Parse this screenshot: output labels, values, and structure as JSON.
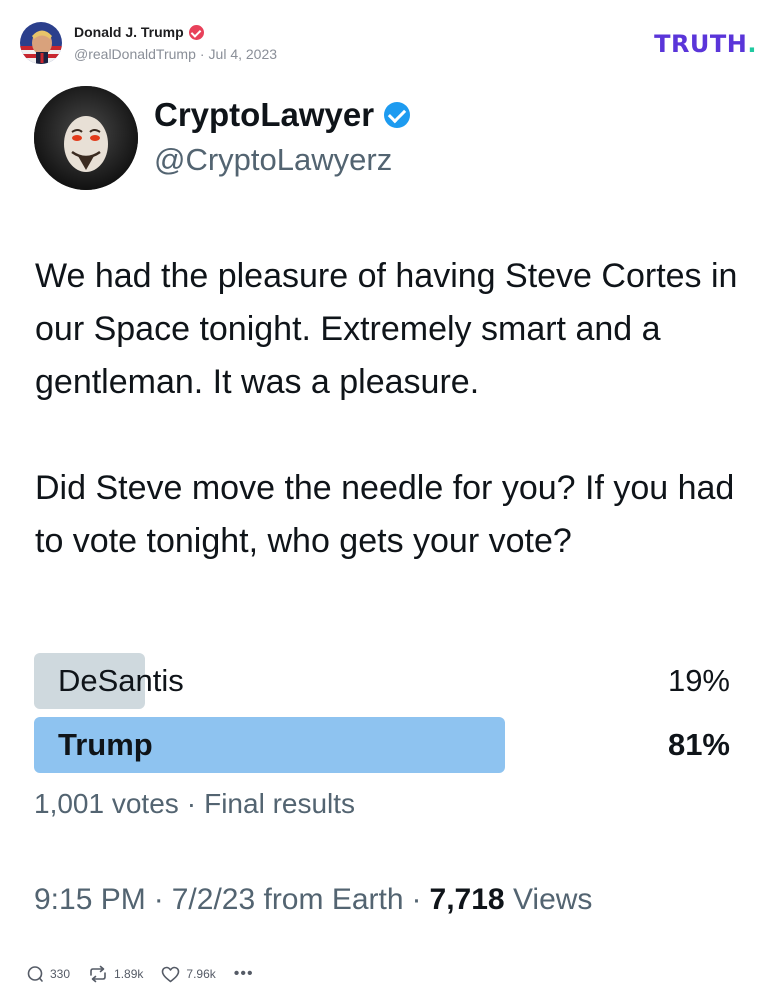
{
  "post": {
    "author_name": "Donald J. Trump",
    "handle": "@realDonaldTrump",
    "separator": "·",
    "date": "Jul 4, 2023",
    "logo_text": "TRUTH",
    "logo_dot": ".",
    "colors": {
      "logo": "#5a35d9",
      "logo_dot": "#20c9a0",
      "verified": "#e8415a"
    }
  },
  "tweet": {
    "name": "CryptoLawyer",
    "handle": "@CryptoLawyerz",
    "paragraph1": "We had the pleasure of having Steve Cortes in our Space tonight. Extremely smart and a gentleman. It was a pleasure.",
    "paragraph2": "Did Steve move the needle for you?  If you had to vote tonight, who gets your vote?",
    "poll": {
      "options": [
        {
          "label": "DeSantis",
          "percent_text": "19%",
          "percent": 19,
          "winner": false
        },
        {
          "label": "Trump",
          "percent_text": "81%",
          "percent": 81,
          "winner": true
        }
      ],
      "votes": "1,001 votes",
      "separator": "·",
      "status": "Final results"
    },
    "time": "9:15 PM",
    "separator": "·",
    "date_source": "7/2/23 from Earth",
    "views_count": "7,718",
    "views_label": "Views",
    "colors": {
      "verified": "#1d9bf0",
      "winner_bar": "#8ec3f0",
      "loser_bar": "#cfd9de"
    }
  },
  "actions": {
    "replies": "330",
    "retruths": "1.89k",
    "likes": "7.96k",
    "more": "•••",
    "icons": [
      "reply-icon",
      "retruth-icon",
      "like-icon",
      "more-icon"
    ]
  }
}
